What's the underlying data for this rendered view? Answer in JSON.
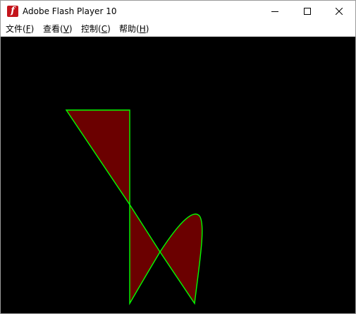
{
  "window": {
    "title": "Adobe Flash Player 10",
    "app_icon_glyph": "f",
    "controls": [
      "minimize-icon",
      "maximize-icon",
      "close-icon"
    ]
  },
  "menu": [
    {
      "label": "文件(",
      "mnemonic": "F",
      "close": ")"
    },
    {
      "label": "查看(",
      "mnemonic": "V",
      "close": ")"
    },
    {
      "label": "控制(",
      "mnemonic": "C",
      "close": ")"
    },
    {
      "label": "帮助(",
      "mnemonic": "H",
      "close": ")"
    }
  ],
  "stage": {
    "background": "#000000",
    "shape_fill": "#6b0000",
    "shape_stroke": "#00ff00"
  }
}
